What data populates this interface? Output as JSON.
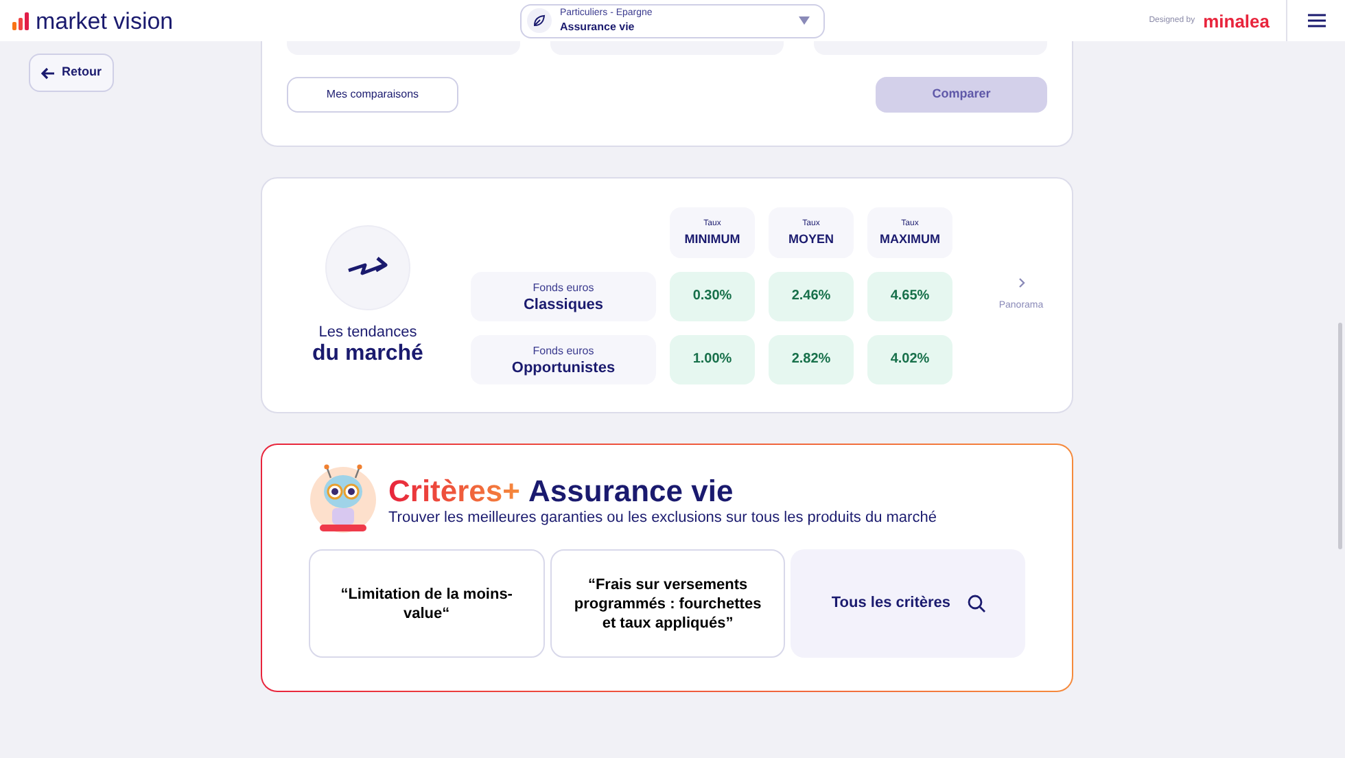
{
  "header": {
    "brand": "market vision",
    "selector": {
      "category": "Particuliers - Epargne",
      "value": "Assurance vie"
    },
    "designed_by": "Designed by",
    "partner": "minalea"
  },
  "back_button": "Retour",
  "comparison_card": {
    "secondary_button": "Mes comparaisons",
    "primary_button": {
      "label": "Comparer",
      "disabled": true
    }
  },
  "market_trends": {
    "title_line_1": "Les tendances",
    "title_line_2": "du marché",
    "columns": [
      {
        "small": "Taux",
        "label": "MINIMUM"
      },
      {
        "small": "Taux",
        "label": "MOYEN"
      },
      {
        "small": "Taux",
        "label": "MAXIMUM"
      }
    ],
    "rows": [
      {
        "small": "Fonds euros",
        "label": "Classiques",
        "values": [
          "0.30%",
          "2.46%",
          "4.65%"
        ]
      },
      {
        "small": "Fonds euros",
        "label": "Opportunistes",
        "values": [
          "1.00%",
          "2.82%",
          "4.02%"
        ]
      }
    ],
    "panorama": "Panorama"
  },
  "criteria": {
    "brand": "Critères+",
    "title": "Assurance vie",
    "subtitle": "Trouver les meilleures garanties ou les exclusions sur tous les produits du marché",
    "cards": [
      {
        "kind": "quote",
        "text": "“Limitation de la moins-value“"
      },
      {
        "kind": "quote",
        "text": "“Frais sur versements programmés : fourchettes et taux appliqués”"
      },
      {
        "kind": "search",
        "text": "Tous les critères"
      }
    ]
  }
}
